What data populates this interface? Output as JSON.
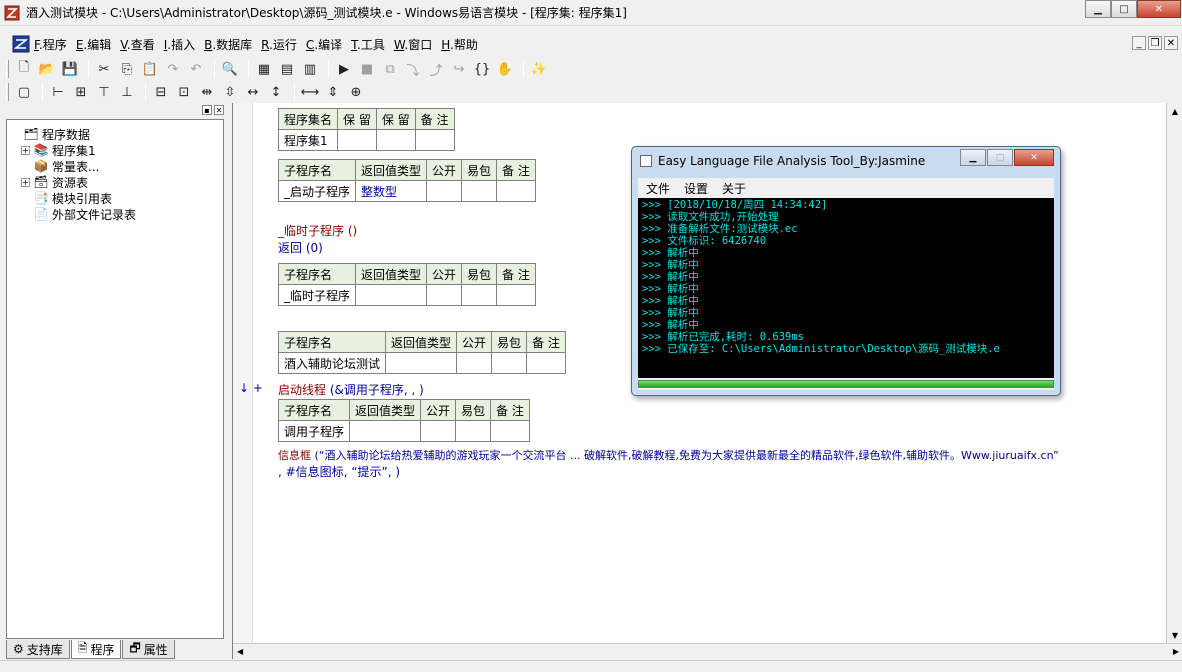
{
  "window": {
    "title": "酒入测试模块 - C:\\Users\\Administrator\\Desktop\\源码_测试模块.e - Windows易语言模块 - [程序集: 程序集1]",
    "minimize": "▁",
    "maximize": "□",
    "close": "✕"
  },
  "menu": {
    "items": [
      {
        "key": "F",
        "label": ".程序"
      },
      {
        "key": "E",
        "label": ".编辑"
      },
      {
        "key": "V",
        "label": ".查看"
      },
      {
        "key": "I",
        "label": ".插入"
      },
      {
        "key": "B",
        "label": ".数据库"
      },
      {
        "key": "R",
        "label": ".运行"
      },
      {
        "key": "C",
        "label": ".编译"
      },
      {
        "key": "T",
        "label": ".工具"
      },
      {
        "key": "W",
        "label": ".窗口"
      },
      {
        "key": "H",
        "label": ".帮助"
      }
    ],
    "mdi_min": "_",
    "mdi_restore": "❐",
    "mdi_close": "✕"
  },
  "toolbar1": [
    {
      "name": "new-file-icon",
      "glyph": "🗋"
    },
    {
      "name": "open-folder-icon",
      "glyph": "📂"
    },
    {
      "name": "save-icon",
      "glyph": "💾"
    },
    {
      "sep": true
    },
    {
      "name": "cut-icon",
      "glyph": "✂"
    },
    {
      "name": "copy-icon",
      "glyph": "⎘"
    },
    {
      "name": "paste-icon",
      "glyph": "📋"
    },
    {
      "name": "redo-icon",
      "glyph": "↷",
      "dim": true
    },
    {
      "name": "undo-icon",
      "glyph": "↶",
      "dim": true
    },
    {
      "sep": true
    },
    {
      "name": "find-icon",
      "glyph": "🔍"
    },
    {
      "sep": true
    },
    {
      "name": "layout-1-icon",
      "glyph": "▦"
    },
    {
      "name": "layout-2-icon",
      "glyph": "▤"
    },
    {
      "name": "layout-3-icon",
      "glyph": "▥"
    },
    {
      "sep": true
    },
    {
      "name": "run-icon",
      "glyph": "▶"
    },
    {
      "name": "stop-icon",
      "glyph": "■",
      "dim": true
    },
    {
      "name": "step-1-icon",
      "glyph": "⧉",
      "dim": true
    },
    {
      "name": "step-2-icon",
      "glyph": "⤵",
      "dim": true
    },
    {
      "name": "step-3-icon",
      "glyph": "⤴",
      "dim": true
    },
    {
      "name": "step-4-icon",
      "glyph": "↪",
      "dim": true
    },
    {
      "name": "braces-icon",
      "glyph": "{}"
    },
    {
      "name": "hand-icon",
      "glyph": "✋"
    },
    {
      "sep": true
    },
    {
      "name": "wizard-icon",
      "glyph": "✨"
    }
  ],
  "toolbar2": [
    {
      "name": "align-1-icon",
      "glyph": "▢"
    },
    {
      "sep": true
    },
    {
      "name": "align-left-icon",
      "glyph": "⊢"
    },
    {
      "name": "align-center-icon",
      "glyph": "⊞"
    },
    {
      "name": "align-top-icon",
      "glyph": "⊤"
    },
    {
      "name": "align-bottom-icon",
      "glyph": "⊥"
    },
    {
      "sep": true
    },
    {
      "name": "hcenter-icon",
      "glyph": "⊟"
    },
    {
      "name": "vcenter-icon",
      "glyph": "⊡"
    },
    {
      "name": "hspace-icon",
      "glyph": "⇹"
    },
    {
      "name": "vspace-icon",
      "glyph": "⇳"
    },
    {
      "name": "hdist-icon",
      "glyph": "↔"
    },
    {
      "name": "vdist-icon",
      "glyph": "↕"
    },
    {
      "sep": true
    },
    {
      "name": "same-width-icon",
      "glyph": "⟷"
    },
    {
      "name": "same-height-icon",
      "glyph": "⇕"
    },
    {
      "name": "same-size-icon",
      "glyph": "⊕"
    }
  ],
  "left_panel": {
    "tree": [
      {
        "indent": 0,
        "exp": "",
        "icon": "🗂",
        "label": "程序数据"
      },
      {
        "indent": 1,
        "exp": "+",
        "icon": "📚",
        "label": "程序集1"
      },
      {
        "indent": 1,
        "exp": "",
        "icon": "📦",
        "label": "常量表..."
      },
      {
        "indent": 1,
        "exp": "+",
        "icon": "🗃",
        "label": "资源表"
      },
      {
        "indent": 1,
        "exp": "",
        "icon": "📑",
        "label": "模块引用表"
      },
      {
        "indent": 1,
        "exp": "",
        "icon": "📄",
        "label": "外部文件记录表"
      }
    ],
    "tabs": [
      {
        "icon": "⚙",
        "label": "支持库"
      },
      {
        "icon": "🗎",
        "label": "程序",
        "active": true
      },
      {
        "icon": "🗗",
        "label": "属性"
      }
    ]
  },
  "editor": {
    "t1": {
      "h": [
        "程序集名",
        "保 留",
        "保 留",
        "备 注"
      ],
      "r": [
        "程序集1",
        "",
        "",
        ""
      ]
    },
    "t2": {
      "h": [
        "子程序名",
        "返回值类型",
        "公开",
        "易包",
        "备 注"
      ],
      "r": [
        "_启动子程序",
        "整数型",
        "",
        "",
        ""
      ]
    },
    "line1": "_临时子程序 ()",
    "line2": "返回 (0)",
    "t3": {
      "h": [
        "子程序名",
        "返回值类型",
        "公开",
        "易包",
        "备 注"
      ],
      "r": [
        "_临时子程序",
        "",
        "",
        "",
        ""
      ]
    },
    "t4": {
      "h": [
        "子程序名",
        "返回值类型",
        "公开",
        "易包",
        "备 注"
      ],
      "r": [
        "酒入辅助论坛测试",
        "",
        "",
        "",
        ""
      ]
    },
    "line3_marker": "↓ +",
    "line3_kw": "启动线程",
    "line3_args": " (&调用子程序, , )",
    "t5": {
      "h": [
        "子程序名",
        "返回值类型",
        "公开",
        "易包",
        "备 注"
      ],
      "r": [
        "调用子程序",
        "",
        "",
        "",
        ""
      ]
    },
    "line4_kw": "信息框",
    "line4_args": " (“酒入辅助论坛给热爱辅助的游戏玩家一个交流平台 ... 破解软件,破解教程,免费为大家提供最新最全的精品软件,绿色软件,辅助软件。Www.jiuruaifx.cn”",
    "line5": ", #信息图标, “提示”, )"
  },
  "tool_window": {
    "title": "Easy Language File Analysis Tool_By:Jasmine",
    "menu": [
      "文件",
      "设置",
      "关于"
    ],
    "console": [
      ">>> [2018/10/18/周四 14:34:42]",
      ">>> 读取文件成功,开始处理",
      ">>> 准备解析文件:测试模块.ec",
      ">>> 文件标识: 6426740",
      ">>> 解析中",
      ">>> 解析中",
      ">>> 解析中",
      ">>> 解析中",
      ">>> 解析中",
      ">>> 解析中",
      ">>> 解析中",
      ">>> 解析已完成,耗时: 0.639ms",
      ">>> 已保存至: C:\\Users\\Administrator\\Desktop\\源码_测试模块.e"
    ],
    "progress": 1.0
  },
  "colors": {
    "keyword_blue": "#0000a0",
    "keyword_maroon": "#8b0000",
    "console_text": "#00e5e5"
  }
}
